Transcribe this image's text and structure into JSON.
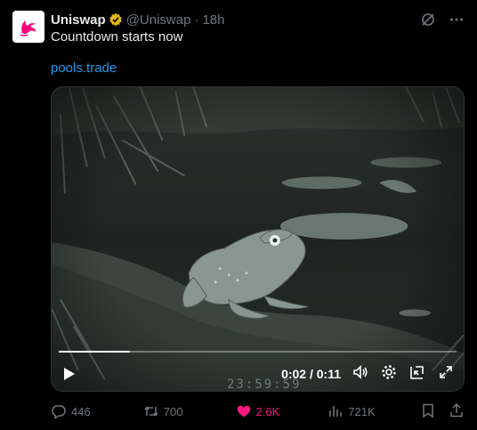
{
  "tweet": {
    "author_name": "Uniswap",
    "handle": "@Uniswap",
    "separator": "·",
    "time": "18h",
    "text": "Countdown starts now",
    "link": "pools.trade"
  },
  "video": {
    "overlay_clock": "23:59:59",
    "timecode": "0:02 / 0:11",
    "progress": 0.18
  },
  "actions": {
    "replies": "446",
    "reposts": "700",
    "likes": "2.6K",
    "views": "721K"
  },
  "colors": {
    "background": "#000000",
    "link": "#1d9bf0",
    "like": "#f91880",
    "muted": "#71767b",
    "verified": "#e2b719",
    "brand": "#ff007a"
  },
  "icons": [
    "uniswap-logo-icon",
    "verified-badge-icon",
    "grok-icon",
    "more-icon",
    "play-icon",
    "volume-icon",
    "settings-icon",
    "pip-icon",
    "fullscreen-icon",
    "reply-icon",
    "repost-icon",
    "like-icon",
    "views-icon",
    "bookmark-icon",
    "share-icon"
  ]
}
